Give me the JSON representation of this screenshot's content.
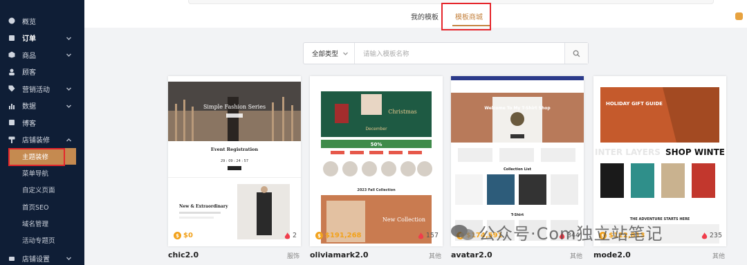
{
  "sidebar": {
    "items": [
      {
        "label": "概览",
        "icon": "dashboard-icon",
        "chevron": false,
        "strong": false
      },
      {
        "label": "订单",
        "icon": "order-icon",
        "chevron": true,
        "strong": true
      },
      {
        "label": "商品",
        "icon": "box-icon",
        "chevron": true,
        "strong": false
      },
      {
        "label": "顾客",
        "icon": "user-icon",
        "chevron": false,
        "strong": false
      },
      {
        "label": "营销活动",
        "icon": "tag-icon",
        "chevron": true,
        "strong": false
      },
      {
        "label": "数据",
        "icon": "chart-icon",
        "chevron": true,
        "strong": false
      },
      {
        "label": "博客",
        "icon": "blog-icon",
        "chevron": false,
        "strong": false
      },
      {
        "label": "店铺装修",
        "icon": "paint-icon",
        "chevron": true,
        "strong": false,
        "expanded": true
      }
    ],
    "sub_items": [
      "主题装修",
      "菜单导航",
      "自定义页面",
      "首页SEO",
      "域名管理",
      "活动专题页"
    ],
    "last_item": {
      "label": "店铺设置",
      "icon": "settings-icon",
      "chevron": true
    }
  },
  "tabs": {
    "mine": "我的模板",
    "store": "模板商城"
  },
  "search": {
    "type_label": "全部类型",
    "placeholder": "请输入模板名称"
  },
  "cards": [
    {
      "name": "chic2.0",
      "tag": "服饰",
      "price": "$0",
      "likes": "2"
    },
    {
      "name": "oliviamark2.0",
      "tag": "其他",
      "price": "$191,268",
      "likes": "157"
    },
    {
      "name": "avatar2.0",
      "tag": "其他",
      "price": "$174,591",
      "likes": "344"
    },
    {
      "name": "mode2.0",
      "tag": "其他",
      "price": "$122,813",
      "likes": "235"
    }
  ],
  "thumb_text": {
    "chic_hero": "Simple Fashion Series",
    "chic_event": "Event Registration",
    "chic_timer": "29 : 09 : 24 : 57",
    "chic_new": "New & Extraordinary",
    "olivia_christmas": "Christmas",
    "olivia_december": "December",
    "olivia_off": "50%",
    "olivia_fall": "2023 Fall Collection",
    "olivia_new": "New Collection",
    "avatar_hero": "Welcome To My T-Shirt Shop",
    "avatar_list": "Collection List",
    "avatar_tshirt": "T-Shirt",
    "mode_gift": "HOLIDAY GIFT GUIDE",
    "mode_layers": "INTER LAYERS",
    "mode_shop": "SHOP WINTE",
    "mode_adventure": "THE ADVENTURE STARTS HERE"
  },
  "watermark": "公众号·Com独立站笔记",
  "colors": {
    "sidebar": "#0f1e36",
    "accent": "#c4823f",
    "highlight_box": "#e5252b",
    "price": "#f2a21c"
  }
}
